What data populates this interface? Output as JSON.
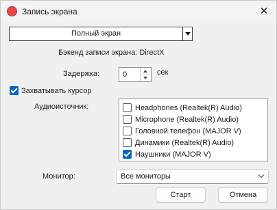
{
  "window": {
    "title": "Запись экрана",
    "close_glyph": "✕",
    "app_icon": "red-circle-icon",
    "accent_color": "#0067c0"
  },
  "capture_mode": {
    "selected": "Полный экран"
  },
  "backend": {
    "text": "Бэкенд записи экрана: DirectX"
  },
  "delay": {
    "label": "Задержка:",
    "value": "0",
    "unit": "сек"
  },
  "capture_cursor": {
    "label": "Захватывать курсор",
    "checked": true
  },
  "audio": {
    "label": "Аудиоисточник:",
    "sources": [
      {
        "label": "Headphones (Realtek(R) Audio)",
        "checked": false
      },
      {
        "label": "Microphone (Realtek(R) Audio)",
        "checked": false
      },
      {
        "label": "Головной телефон (MAJOR V)",
        "checked": false
      },
      {
        "label": "Динамики (Realtek(R) Audio)",
        "checked": false
      },
      {
        "label": "Наушники (MAJOR V)",
        "checked": true
      }
    ]
  },
  "monitor": {
    "label": "Монитор:",
    "selected": "Все мониторы"
  },
  "buttons": {
    "start": "Старт",
    "cancel": "Отмена"
  }
}
